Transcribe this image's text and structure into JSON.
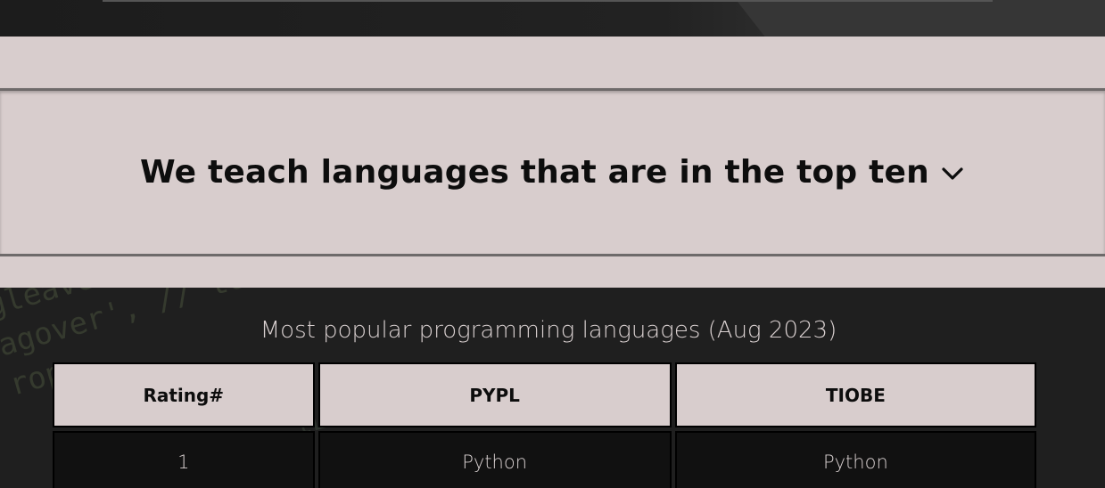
{
  "accordion": {
    "title": "We teach languages that are in the top ten",
    "toggle_icon": "chevron-down-icon"
  },
  "table": {
    "caption": "Most popular programming languages (Aug 2023)",
    "headers": [
      "Rating#",
      "PYPL",
      "TIOBE"
    ],
    "rows": [
      [
        "1",
        "Python",
        "Python"
      ]
    ]
  },
  "colors": {
    "panel_bg": "#d8cdcd",
    "dark_bg": "#1f1f1f",
    "cell_bg": "#111111",
    "text_dark": "#0d0d0d",
    "text_light": "#d8d0d0"
  }
}
